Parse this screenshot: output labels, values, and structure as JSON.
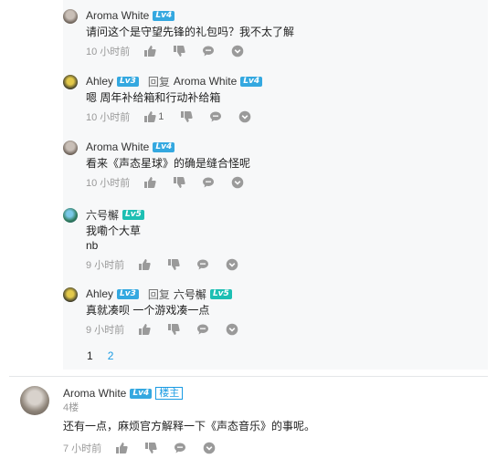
{
  "replies": [
    {
      "user": "Aroma White",
      "level": "Lv4",
      "reply_to": null,
      "reply_to_level": null,
      "lines": [
        "请问这个是守望先锋的礼包吗？我不太了解"
      ],
      "time": "10 小时前",
      "likes": ""
    },
    {
      "user": "Ahley",
      "level": "Lv3",
      "reply_label": "回复",
      "reply_to": "Aroma White",
      "reply_to_level": "Lv4",
      "lines": [
        "嗯 周年补给箱和行动补给箱"
      ],
      "time": "10 小时前",
      "likes": "1"
    },
    {
      "user": "Aroma White",
      "level": "Lv4",
      "reply_to": null,
      "reply_to_level": null,
      "lines": [
        "看来《声态星球》的确是缝合怪呢"
      ],
      "time": "10 小时前",
      "likes": ""
    },
    {
      "user": "六号檞",
      "level": "Lv5",
      "reply_to": null,
      "reply_to_level": null,
      "lines": [
        "我嘞个大草",
        "nb"
      ],
      "time": "9 小时前",
      "likes": ""
    },
    {
      "user": "Ahley",
      "level": "Lv3",
      "reply_label": "回复",
      "reply_to": "六号檞",
      "reply_to_level": "Lv5",
      "lines": [
        "真就凑呗 一个游戏凑一点"
      ],
      "time": "9 小时前",
      "likes": ""
    }
  ],
  "pagination": {
    "pages": [
      "1",
      "2"
    ],
    "current": "1"
  },
  "main_comment": {
    "user": "Aroma White",
    "level": "Lv4",
    "owner_badge": "楼主",
    "floor": "4楼",
    "text": "还有一点，麻烦官方解释一下《声态音乐》的事呢。",
    "time": "7 小时前"
  },
  "colors": {
    "level_blue": "#34a8e0",
    "level_teal": "#1dbfb3",
    "link": "#1a9be3",
    "sub_bg": "#f7f8f9"
  },
  "icons": [
    "thumb-up-icon",
    "thumb-down-icon",
    "comment-icon",
    "more-icon"
  ]
}
